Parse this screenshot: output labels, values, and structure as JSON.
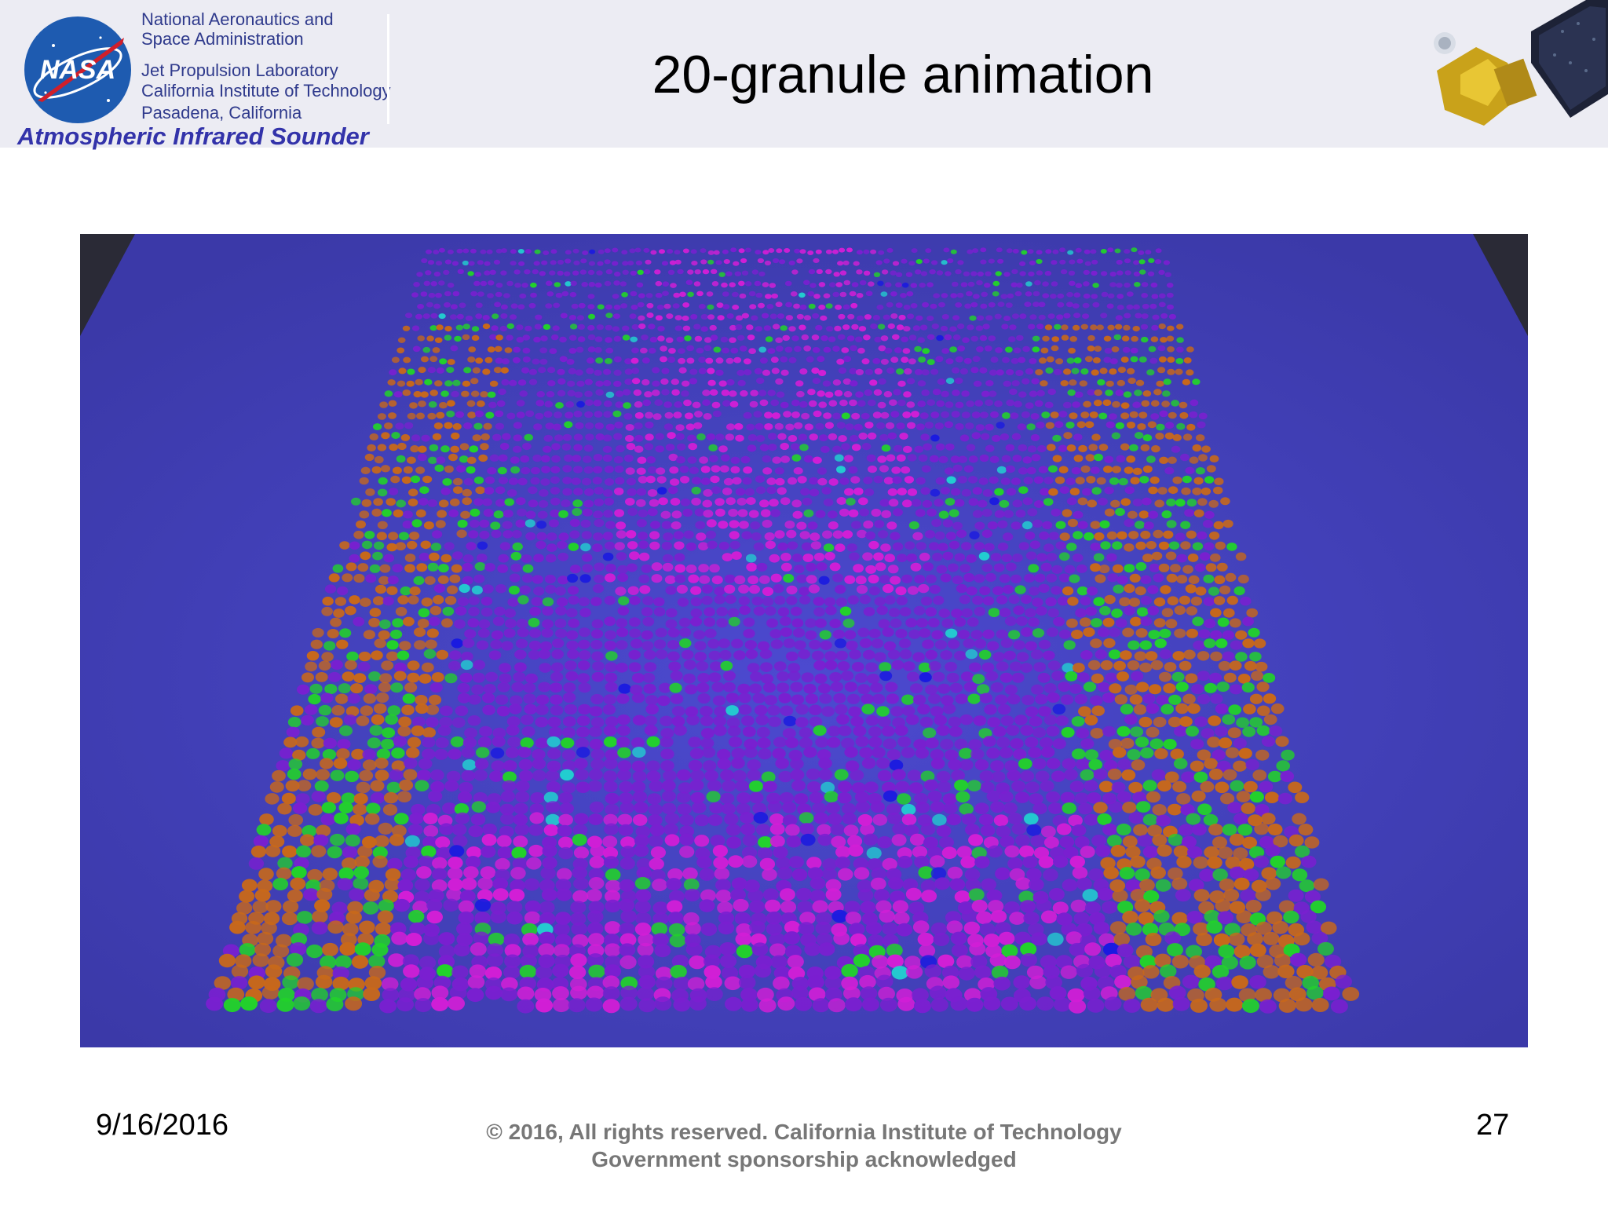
{
  "header": {
    "org_lines": [
      "National Aeronautics and",
      "Space Administration",
      "Jet Propulsion Laboratory",
      "California Institute of Technology",
      "Pasadena, California"
    ],
    "brand": "Atmospheric Infrared Sounder",
    "logo_text": "NASA"
  },
  "slide": {
    "title": "20-granule animation"
  },
  "visualization": {
    "icon": "3d-granule-point-cloud",
    "colors": {
      "background": "#4a47c2",
      "purple": "#7a1fd0",
      "magenta": "#d21ed6",
      "orange": "#c8681a",
      "green": "#22d22a",
      "blue": "#1a1ae0",
      "cyan": "#22d0d0"
    }
  },
  "footer": {
    "date": "9/16/2016",
    "copyright_line1": "© 2016, All rights reserved. California Institute of Technology",
    "copyright_line2": "Government sponsorship acknowledged",
    "page_number": "27"
  }
}
